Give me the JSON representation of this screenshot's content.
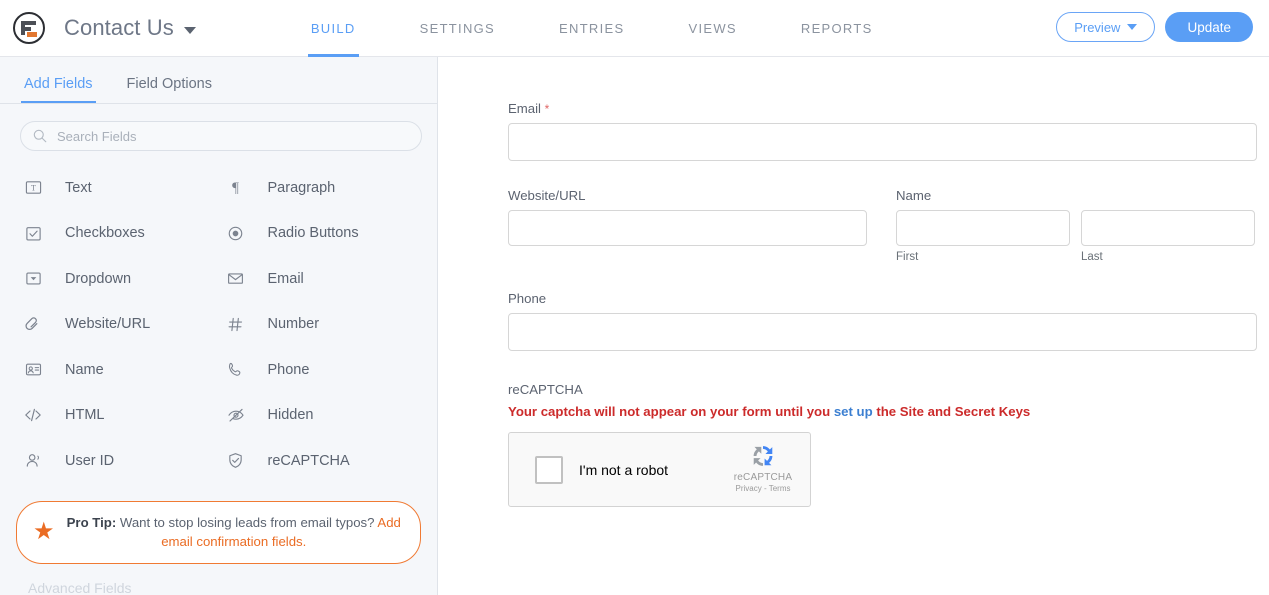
{
  "topbar": {
    "logo_icon": "wpforms-logo-icon",
    "form_title": "Contact Us",
    "title_caret_icon": "chevron-down-icon",
    "nav": [
      {
        "label": "BUILD",
        "active": true
      },
      {
        "label": "SETTINGS",
        "active": false
      },
      {
        "label": "ENTRIES",
        "active": false
      },
      {
        "label": "VIEWS",
        "active": false
      },
      {
        "label": "REPORTS",
        "active": false
      }
    ],
    "preview_label": "Preview",
    "preview_caret_icon": "chevron-down-icon",
    "update_label": "Update",
    "accent_color": "#5a9ef5"
  },
  "sidebar": {
    "tabs": [
      {
        "label": "Add Fields",
        "active": true
      },
      {
        "label": "Field Options",
        "active": false
      }
    ],
    "search": {
      "icon": "search-icon",
      "placeholder": "Search Fields",
      "value": ""
    },
    "fields": [
      {
        "label": "Text",
        "icon": "text-field-icon"
      },
      {
        "label": "Paragraph",
        "icon": "paragraph-icon"
      },
      {
        "label": "Checkboxes",
        "icon": "checkbox-icon"
      },
      {
        "label": "Radio Buttons",
        "icon": "radio-button-icon"
      },
      {
        "label": "Dropdown",
        "icon": "dropdown-icon"
      },
      {
        "label": "Email",
        "icon": "envelope-icon"
      },
      {
        "label": "Website/URL",
        "icon": "link-icon"
      },
      {
        "label": "Number",
        "icon": "hash-icon"
      },
      {
        "label": "Name",
        "icon": "id-card-icon"
      },
      {
        "label": "Phone",
        "icon": "phone-icon"
      },
      {
        "label": "HTML",
        "icon": "code-icon"
      },
      {
        "label": "Hidden",
        "icon": "eye-slash-icon"
      },
      {
        "label": "User ID",
        "icon": "user-icon"
      },
      {
        "label": "reCAPTCHA",
        "icon": "shield-check-icon"
      }
    ],
    "protip": {
      "star_icon": "star-icon",
      "bold": "Pro Tip:",
      "text": " Want to stop losing leads from email typos? ",
      "link": "Add email confirmation fields.",
      "border_color": "#f07a33"
    },
    "advanced_fields_label": "Advanced Fields"
  },
  "form": {
    "email": {
      "label": "Email",
      "required_marker": "*",
      "value": ""
    },
    "website": {
      "label": "Website/URL",
      "value": ""
    },
    "name": {
      "label": "Name",
      "first": {
        "sub_label": "First",
        "value": ""
      },
      "last": {
        "sub_label": "Last",
        "value": ""
      }
    },
    "phone": {
      "label": "Phone",
      "value": ""
    },
    "recaptcha": {
      "label": "reCAPTCHA",
      "warning_before": "Your captcha will not appear on your form until you ",
      "warning_link": "set up",
      "warning_after": " the Site and Secret Keys",
      "warning_color": "#cc2b2b",
      "link_color": "#3c7fd1",
      "checkbox_label": "I'm not a robot",
      "brand_name": "reCAPTCHA",
      "brand_terms": "Privacy - Terms",
      "brand_icon": "recaptcha-logo-icon"
    }
  }
}
